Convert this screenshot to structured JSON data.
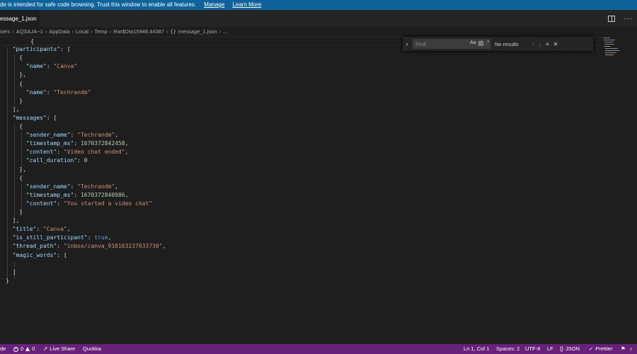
{
  "banner": {
    "message": "de is intended for safe code browsing. Trust this window to enable all features.",
    "manage_link": "Manage",
    "learn_more_link": "Learn More"
  },
  "tab": {
    "label": "essage_1.json"
  },
  "breadcrumb": {
    "items": [
      "sers",
      "AQSAJA~1",
      "AppData",
      "Local",
      "Temp",
      "Rar$DIa15948.44387"
    ],
    "file_icon": "{}",
    "file": "message_1.json",
    "trailing": "..."
  },
  "find": {
    "placeholder": "Find",
    "opt_case": "Aa",
    "opt_word": "ab",
    "opt_regex": ".*",
    "results": "No results"
  },
  "status": {
    "left_mode": "de",
    "errors": "0",
    "warnings": "0",
    "live_share": "Live Share",
    "quokka": "Quokka",
    "position": "Ln 1, Col 1",
    "spaces": "Spaces: 2",
    "encoding": "UTF-8",
    "eol": "LF",
    "language": "JSON",
    "prettier": "Prettier"
  },
  "code": {
    "l1": "{",
    "participants_key": "\"participants\"",
    "name_key": "\"name\"",
    "canva": "\"Canva\"",
    "techrandm": "\"Techrandm\"",
    "messages_key": "\"messages\"",
    "sender_name_key": "\"sender_name\"",
    "timestamp_key": "\"timestamp_ms\"",
    "content_key": "\"content\"",
    "call_duration_key": "\"call_duration\"",
    "ts1": "1670372842458",
    "content1": "\"Video chat ended\"",
    "duration": "0",
    "ts2": "1670372840986",
    "content2": "\"You started a video chat\"",
    "title_key": "\"title\"",
    "is_still_key": "\"is_still_participant\"",
    "true_val": "true",
    "thread_path_key": "\"thread_path\"",
    "thread_path_val": "\"inbox/canva_910163237033730\"",
    "magic_words_key": "\"magic_words\""
  },
  "colors": {
    "banner": "#0e639c",
    "statusbar": "#68217a",
    "key": "#9cdcfe",
    "string": "#ce9178",
    "number": "#b5cea8",
    "boolean": "#569cd6"
  }
}
